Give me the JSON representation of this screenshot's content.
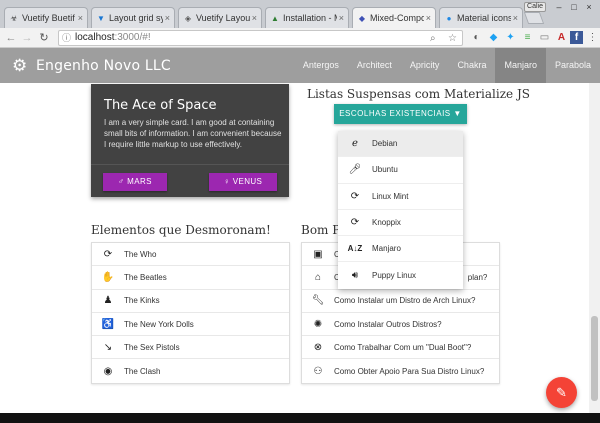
{
  "browser": {
    "tabs": [
      {
        "title": "Vuetify Buetif",
        "icon": "biohazard-icon"
      },
      {
        "title": "Layout grid sys",
        "icon": "vuetify-icon"
      },
      {
        "title": "Vuetify Layout",
        "icon": "vuetify-icon"
      },
      {
        "title": "Installation - M",
        "icon": "materialize-icon"
      },
      {
        "title": "Mixed-Compone",
        "icon": "vue-icon"
      },
      {
        "title": "Material icons",
        "icon": "material-icon"
      }
    ],
    "user_chip": "Calie",
    "url_host": "localhost",
    "url_rest": ":3000/#!"
  },
  "appbar": {
    "brand": "Engenho Novo LLC",
    "menu": [
      "Antergos",
      "Architect",
      "Apricity",
      "Chakra",
      "Manjaro",
      "Parabola"
    ],
    "active_menu": "Manjaro"
  },
  "card": {
    "title": "The Ace of Space",
    "text": "I am a very simple card. I am good at containing small bits of information. I am convenient because I require little markup to use effectively.",
    "btn_mars": "MARS",
    "btn_venus": "VENUS"
  },
  "dropdown": {
    "title": "Listas Suspensas com Materialize JS",
    "button_label": "ESCOLHAS EXISTENCIAIS",
    "options": [
      {
        "label": "Debian",
        "icon": "ear-icon"
      },
      {
        "label": "Ubuntu",
        "icon": "mic-icon"
      },
      {
        "label": "Linux Mint",
        "icon": "refresh-icon"
      },
      {
        "label": "Knoppix",
        "icon": "refresh-icon"
      },
      {
        "label": "Manjaro",
        "icon": "sort-az-icon"
      },
      {
        "label": "Puppy Linux",
        "icon": "volume-icon"
      }
    ]
  },
  "left_list": {
    "title": "Elementos que Desmoronam!",
    "items": [
      {
        "label": "The Who",
        "icon": "refresh-icon"
      },
      {
        "label": "The Beatles",
        "icon": "hand-icon"
      },
      {
        "label": "The Kinks",
        "icon": "person-icon"
      },
      {
        "label": "The New York Dolls",
        "icon": "accessible-icon"
      },
      {
        "label": "The Sex Pistols",
        "icon": "trending-down-icon"
      },
      {
        "label": "The Clash",
        "icon": "eye-icon"
      }
    ]
  },
  "right_list": {
    "title": "Bom Po",
    "items": [
      {
        "label": "C",
        "icon": "monitor-icon"
      },
      {
        "label": "C",
        "icon": "bank-icon",
        "suffix": "plan?"
      },
      {
        "label": "Como Instalar um Distro de Arch Linux?",
        "icon": "wrench-icon"
      },
      {
        "label": "Como Instalar Outros Distros?",
        "icon": "bug-icon"
      },
      {
        "label": "Como Trabalhar Com um \"Dual Boot\"?",
        "icon": "cancel-icon"
      },
      {
        "label": "Como Obter Apoio Para Sua Distro Linux?",
        "icon": "motorcycle-icon"
      }
    ]
  },
  "colors": {
    "appbar": "#9e9e9e",
    "card_bg": "#424242",
    "card_button": "#9c27b0",
    "dropdown_button": "#26a69a",
    "fab": "#f44336"
  }
}
